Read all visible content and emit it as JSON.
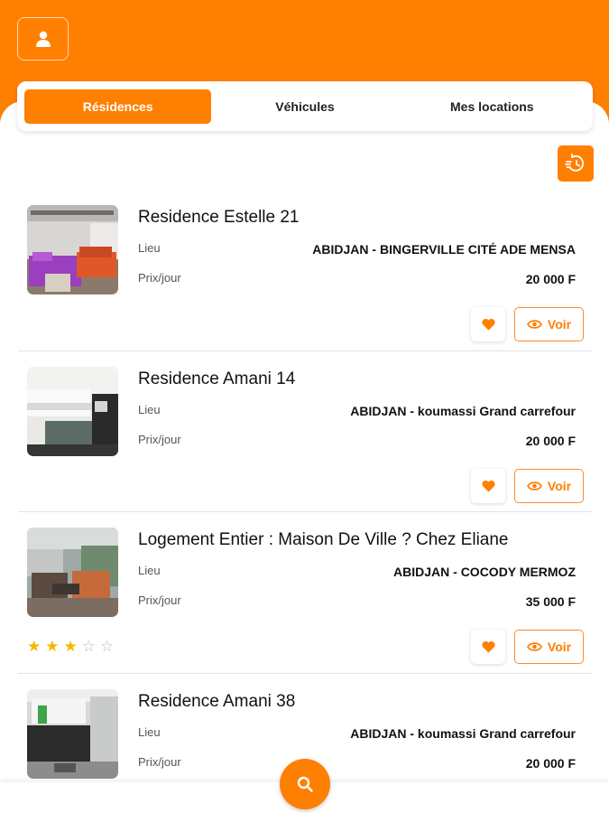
{
  "tabs": [
    {
      "label": "Résidences",
      "active": true
    },
    {
      "label": "Véhicules",
      "active": false
    },
    {
      "label": "Mes locations",
      "active": false
    }
  ],
  "header": {
    "profile_icon": "user-icon",
    "refresh_icon": "refresh-icon"
  },
  "labels": {
    "lieu": "Lieu",
    "prix": "Prix/jour",
    "voir": "Voir"
  },
  "listings": [
    {
      "title": "Residence Estelle 21",
      "location": "ABIDJAN - BINGERVILLE CITÉ ADE MENSA",
      "price": "20 000 F",
      "rating": null
    },
    {
      "title": "Residence Amani 14",
      "location": "ABIDJAN - koumassi Grand carrefour",
      "price": "20 000 F",
      "rating": null
    },
    {
      "title": "Logement Entier : Maison De Ville ? Chez Eliane",
      "location": "ABIDJAN - COCODY MERMOZ",
      "price": "35 000 F",
      "rating": 3
    },
    {
      "title": "Residence Amani 38",
      "location": "ABIDJAN - koumassi Grand carrefour",
      "price": "20 000 F",
      "rating": null
    }
  ],
  "colors": {
    "accent": "#ff7f00",
    "star": "#f5b800"
  }
}
